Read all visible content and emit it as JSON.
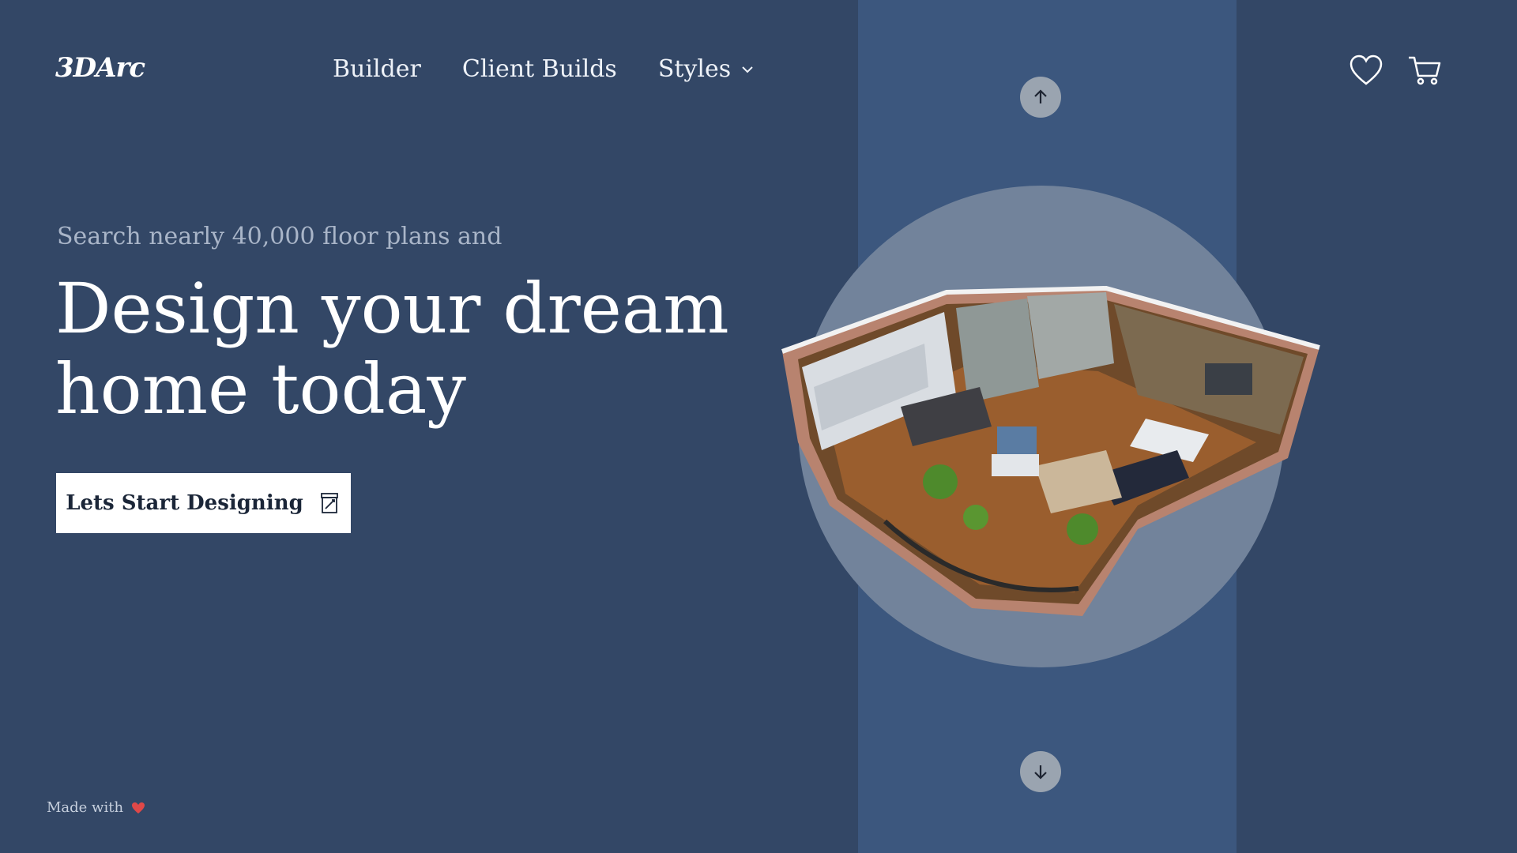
{
  "brand": {
    "logo": "3DArc"
  },
  "nav": {
    "items": [
      {
        "label": "Builder"
      },
      {
        "label": "Client Builds"
      },
      {
        "label": "Styles"
      }
    ]
  },
  "header_icons": [
    "heart-icon",
    "cart-icon"
  ],
  "hero": {
    "subtitle": "Search nearly 40,000 floor plans and",
    "headline_line1": "Design your dream",
    "headline_line2": "home today",
    "cta_label": "Lets Start Designing",
    "cta_icon": "design-edit-icon"
  },
  "carousel": {
    "up_icon": "arrow-up-icon",
    "down_icon": "arrow-down-icon",
    "image": "3d-floor-plan-apartment"
  },
  "footer": {
    "made_with": "Made with",
    "heart_color": "#e04848"
  },
  "colors": {
    "background": "#334766",
    "band": "#3c577e",
    "disc": "#72839b",
    "cta_bg": "#ffffff",
    "subtitle": "#a9b5c8"
  }
}
